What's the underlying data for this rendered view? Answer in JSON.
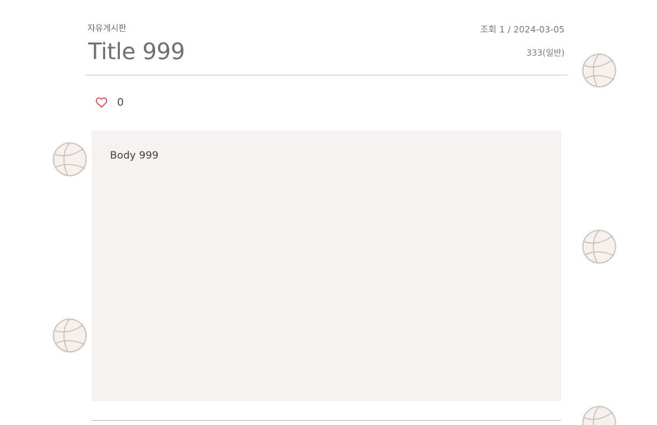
{
  "post": {
    "category": "자유게시판",
    "title": "Title 999",
    "meta": "조회 1 / 2024-03-05",
    "author": "333(일반)",
    "like_count": "0",
    "body": "Body 999"
  },
  "icons": {
    "like": "heart-outline-icon",
    "decoration": "volleyball-icon"
  },
  "colors": {
    "heart": "#e0474c",
    "body_background": "#f6f2f1",
    "ball_fill": "#f6f1ee"
  }
}
